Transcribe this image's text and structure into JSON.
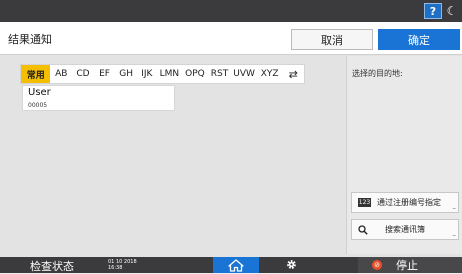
{
  "header": {
    "help_label": "?",
    "moon_label": "☾"
  },
  "dialog": {
    "title": "结果通知",
    "cancel_label": "取消",
    "ok_label": "确定"
  },
  "tabs": [
    {
      "label": "常用",
      "active": true
    },
    {
      "label": "AB"
    },
    {
      "label": "CD"
    },
    {
      "label": "EF"
    },
    {
      "label": "GH"
    },
    {
      "label": "IJK"
    },
    {
      "label": "LMN"
    },
    {
      "label": "OPQ"
    },
    {
      "label": "RST"
    },
    {
      "label": "UVW"
    },
    {
      "label": "XYZ"
    }
  ],
  "entries": [
    {
      "name": "User",
      "number": "00005"
    }
  ],
  "right_panel": {
    "destination_label": "选择的目的地:",
    "register_label": "通过注册编号指定",
    "register_icon_text": "123",
    "address_book_label": "搜索通讯簿"
  },
  "status_bar": {
    "status_label": "检查状态",
    "date_line1": "01 10 2018",
    "date_line2": "16:38",
    "stop_label": "停止"
  },
  "colors": {
    "accent": "#1a74d6",
    "active_tab": "#f5bf00",
    "top_bar": "#3b3b3d",
    "stop_icon": "#e8502c"
  }
}
